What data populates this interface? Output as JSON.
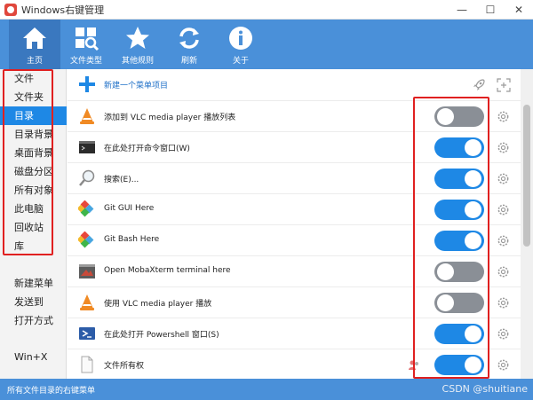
{
  "window": {
    "title": "Windows右键管理",
    "min": "—",
    "max": "☐",
    "close": "✕"
  },
  "toolbar": {
    "items": [
      {
        "label": "主页",
        "icon": "home-icon"
      },
      {
        "label": "文件类型",
        "icon": "file-types-icon"
      },
      {
        "label": "其他规则",
        "icon": "star-icon"
      },
      {
        "label": "刷新",
        "icon": "refresh-icon"
      },
      {
        "label": "关于",
        "icon": "info-icon"
      }
    ]
  },
  "sidebar": {
    "items": [
      {
        "label": "文件"
      },
      {
        "label": "文件夹"
      },
      {
        "label": "目录"
      },
      {
        "label": "目录背景"
      },
      {
        "label": "桌面背景"
      },
      {
        "label": "磁盘分区"
      },
      {
        "label": "所有对象"
      },
      {
        "label": "此电脑"
      },
      {
        "label": "回收站"
      },
      {
        "label": "库"
      },
      {
        "label": "新建菜单"
      },
      {
        "label": "发送到"
      },
      {
        "label": "打开方式"
      },
      {
        "label": "Win+X"
      }
    ],
    "active_index": 2
  },
  "main": {
    "new_item_label": "新建一个菜单项目",
    "rows": [
      {
        "label": "添加到 VLC media player 播放列表",
        "icon": "vlc-icon",
        "enabled": false
      },
      {
        "label": "在此处打开命令窗口(W)",
        "icon": "cmd-icon",
        "enabled": true
      },
      {
        "label": "搜索(E)...",
        "icon": "search-icon",
        "enabled": true
      },
      {
        "label": "Git GUI Here",
        "icon": "git-icon",
        "enabled": true
      },
      {
        "label": "Git Bash Here",
        "icon": "git-icon",
        "enabled": true
      },
      {
        "label": "Open MobaXterm terminal here",
        "icon": "mobaxterm-icon",
        "enabled": false
      },
      {
        "label": "使用 VLC media player 播放",
        "icon": "vlc-icon",
        "enabled": false
      },
      {
        "label": "在此处打开 Powershell 窗口(S)",
        "icon": "powershell-icon",
        "enabled": true
      },
      {
        "label": "文件所有权",
        "icon": "document-icon",
        "enabled": true
      }
    ]
  },
  "status": {
    "text": "所有文件目录的右键菜单",
    "watermark": "CSDN @shuitiane"
  },
  "colors": {
    "accent": "#4a90d9",
    "toggle_on": "#1e88e5",
    "toggle_off": "#8a8f96",
    "highlight_box": "#e02020"
  }
}
